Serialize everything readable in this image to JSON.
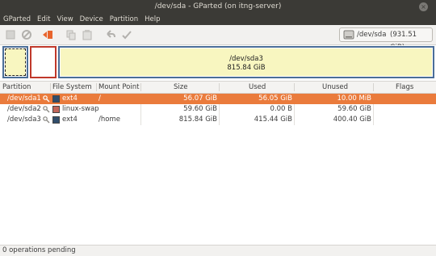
{
  "window": {
    "title": "/dev/sda - GParted (on itng-server)",
    "close_glyph": "×"
  },
  "menu": [
    "GParted",
    "Edit",
    "View",
    "Device",
    "Partition",
    "Help"
  ],
  "toolbar": {
    "icons": [
      "new-icon",
      "delete-icon",
      "resize-move-icon",
      "copy-icon",
      "paste-icon",
      "undo-icon",
      "apply-icon"
    ],
    "device": "/dev/sda",
    "device_size": "(931.51 GiB)"
  },
  "map": {
    "sda3_label": "/dev/sda3",
    "sda3_size": "815.84 GiB"
  },
  "columns": [
    "Partition",
    "File System",
    "Mount Point",
    "Size",
    "Used",
    "Unused",
    "Flags"
  ],
  "rows": [
    {
      "partition": "/dev/sda1",
      "fs": "ext4",
      "fs_color": "#314e6c",
      "mount": "/",
      "size": "56.07 GiB",
      "used": "56.05 GiB",
      "unused": "10.00 MiB",
      "flags": ""
    },
    {
      "partition": "/dev/sda2",
      "fs": "linux-swap",
      "fs_color": "#c1665a",
      "mount": "",
      "size": "59.60 GiB",
      "used": "0.00 B",
      "unused": "59.60 GiB",
      "flags": ""
    },
    {
      "partition": "/dev/sda3",
      "fs": "ext4",
      "fs_color": "#314e6c",
      "mount": "/home",
      "size": "815.84 GiB",
      "used": "415.44 GiB",
      "unused": "400.40 GiB",
      "flags": ""
    }
  ],
  "status": "0 operations pending"
}
